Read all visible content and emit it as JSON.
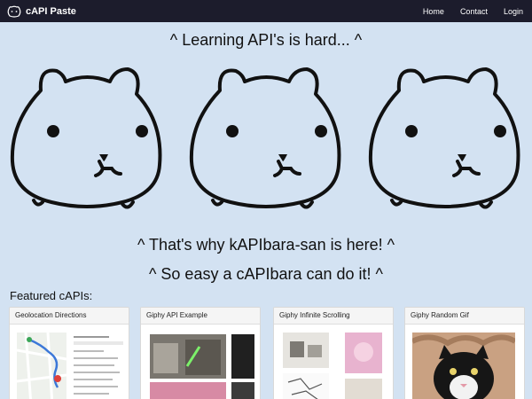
{
  "nav": {
    "brand": "cAPI Paste",
    "links": [
      "Home",
      "Contact",
      "Login"
    ]
  },
  "hero": {
    "title": "^ Learning API's is hard... ^",
    "subtitle1": "^ That's why kAPIbara-san is here! ^",
    "subtitle2": "^ So easy a cAPIbara can do it! ^"
  },
  "featured": {
    "heading": "Featured cAPIs:",
    "cards": [
      {
        "title": "Geolocation Directions",
        "icon": "map-icon"
      },
      {
        "title": "Giphy API Example",
        "icon": "image-grid-icon"
      },
      {
        "title": "Giphy Infinite Scrolling",
        "icon": "image-grid-icon"
      },
      {
        "title": "Giphy Random Gif",
        "icon": "cat-photo-icon"
      }
    ]
  },
  "colors": {
    "navbar": "#1c1c2c",
    "page_background": "#d3e2f2",
    "map_route": "#3c78d8",
    "map_marker": "#e0413b"
  }
}
